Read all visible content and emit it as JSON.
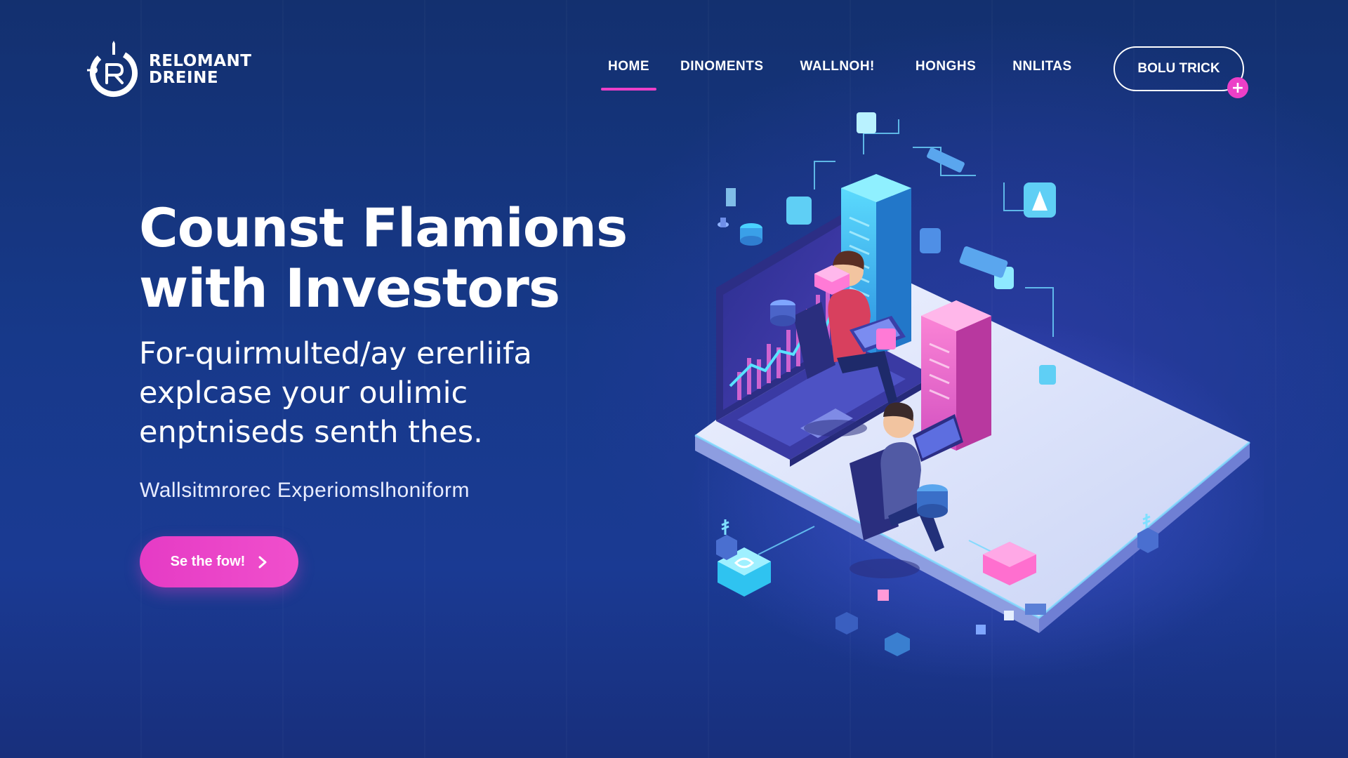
{
  "brand": {
    "line1": "RELOMANT",
    "line2": "DREINE"
  },
  "nav": {
    "items": [
      {
        "label": "HOME",
        "active": true
      },
      {
        "label": "DINOMENTS",
        "active": false
      },
      {
        "label": "WALLNOH!",
        "active": false
      },
      {
        "label": "HONGHS",
        "active": false
      },
      {
        "label": "NNLITAS",
        "active": false
      }
    ],
    "cta_label": "BOLU TRICK",
    "cta_badge": "+"
  },
  "hero": {
    "headline_line1": "Counst Flamions",
    "headline_line2": "with Investors",
    "subhead_line1": "For-quirmulted/ay ererliifa",
    "subhead_line2": "explcase your oulimic",
    "subhead_line3": "enptniseds senth thes.",
    "tagline": "Wallsitmrorec Experiomslhoniform",
    "cta_label": "Se the fow!"
  },
  "colors": {
    "accent": "#ec3fc7",
    "background_top": "#13306f",
    "background_bottom": "#1a3a93",
    "platform": "#dde4f8",
    "cyan": "#39c6f0"
  },
  "icons": {
    "logo": "brand-logo-icon",
    "cta_arrow": "chevron-right-icon",
    "badge": "plus-icon"
  }
}
